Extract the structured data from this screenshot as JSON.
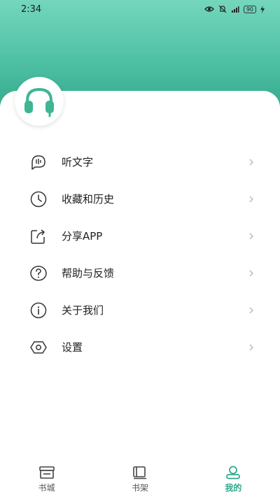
{
  "status_bar": {
    "time": "2:34",
    "battery": "90"
  },
  "theme": {
    "accent": "#2fa98b",
    "header_gradient_top": "#74d6bd",
    "header_gradient_bottom": "#34a98c"
  },
  "profile": {
    "avatar_icon": "headphones-icon"
  },
  "menu": {
    "items": [
      {
        "label": "听文字",
        "icon": "listen-speech-icon"
      },
      {
        "label": "收藏和历史",
        "icon": "clock-icon"
      },
      {
        "label": "分享APP",
        "icon": "share-icon"
      },
      {
        "label": "帮助与反馈",
        "icon": "help-icon"
      },
      {
        "label": "关于我们",
        "icon": "info-icon"
      },
      {
        "label": "设置",
        "icon": "hexagon-settings-icon"
      }
    ]
  },
  "tabbar": {
    "tabs": [
      {
        "label": "书城",
        "icon": "bookstore-icon",
        "active": false
      },
      {
        "label": "书架",
        "icon": "bookshelf-icon",
        "active": false
      },
      {
        "label": "我的",
        "icon": "profile-icon",
        "active": true
      }
    ]
  }
}
